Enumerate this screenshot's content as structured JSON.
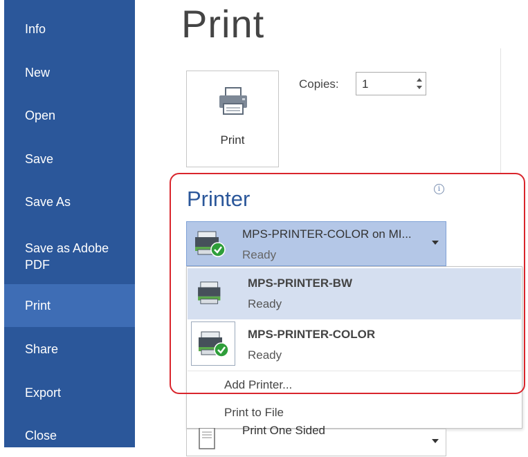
{
  "nav": {
    "items": [
      {
        "label": "Info"
      },
      {
        "label": "New"
      },
      {
        "label": "Open"
      },
      {
        "label": "Save"
      },
      {
        "label": "Save As"
      },
      {
        "label": "Save as Adobe PDF"
      },
      {
        "label": "Print",
        "active": true
      },
      {
        "label": "Share"
      },
      {
        "label": "Export"
      },
      {
        "label": "Close"
      }
    ]
  },
  "page_title": "Print",
  "print_button": {
    "label": "Print",
    "icon": "printer-icon"
  },
  "copies": {
    "label": "Copies:",
    "value": "1"
  },
  "printer": {
    "heading": "Printer",
    "info_icon": "info-icon",
    "selected": {
      "name": "MPS-PRINTER-COLOR on MI...",
      "status": "Ready"
    },
    "options": [
      {
        "name": "MPS-PRINTER-BW",
        "status": "Ready",
        "highlighted": true
      },
      {
        "name": "MPS-PRINTER-COLOR",
        "status": "Ready",
        "default": true
      }
    ],
    "actions": {
      "add_printer": "Add Printer...",
      "print_to_file": "Print to File"
    }
  },
  "settings": {
    "sides": "Print One Sided"
  },
  "colors": {
    "nav_bg": "#2b579a",
    "nav_active": "#3e6db5",
    "accent": "#2b579a",
    "highlight_frame": "#d9252c"
  }
}
